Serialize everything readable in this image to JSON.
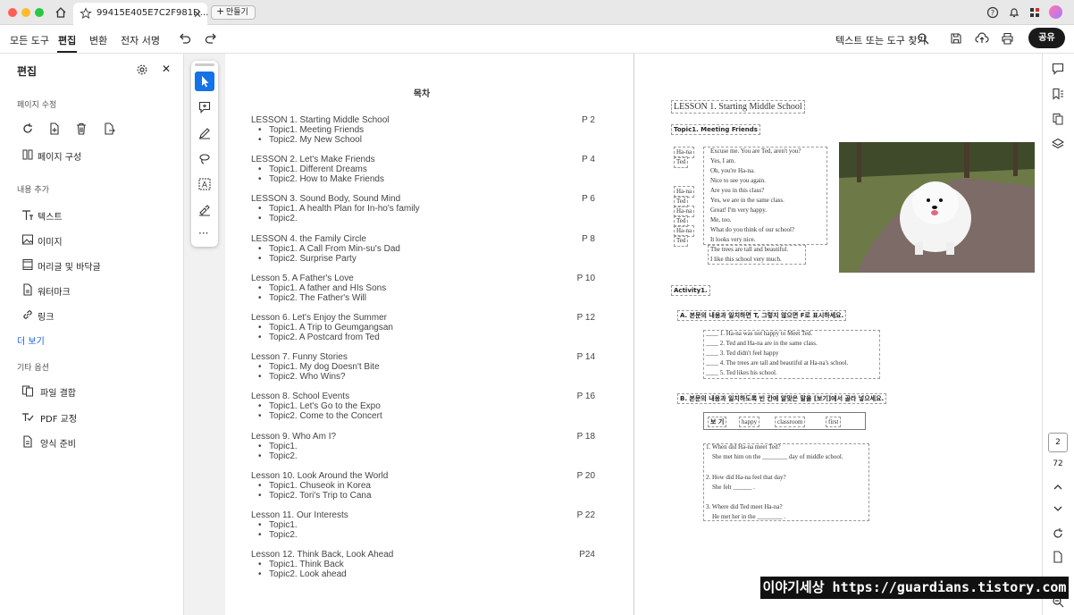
{
  "window": {
    "tab_title": "99415E405E7C2F981D...",
    "new_tab_label": "만들기"
  },
  "menu": {
    "all_tools": "모든 도구",
    "edit": "편집",
    "convert": "변환",
    "esign": "전자 서명",
    "search_label": "텍스트 또는 도구 찾기",
    "share": "공유"
  },
  "sidebar": {
    "title": "편집",
    "sections": {
      "page_edit": "페이지 수정",
      "add_content": "내용 추가",
      "other": "기타 옵션"
    },
    "page_compose": "페이지 구성",
    "add_items": [
      "텍스트",
      "이미지",
      "머리글 및 바닥글",
      "워터마크",
      "링크"
    ],
    "more": "더 보기",
    "other_items": [
      "파일 결합",
      "PDF 교정",
      "양식 준비"
    ]
  },
  "toc": {
    "title": "목차",
    "lessons": [
      {
        "title": "LESSON 1. Starting Middle School",
        "page": "P 2",
        "topics": [
          "Topic1. Meeting Friends",
          "Topic2. My New School"
        ]
      },
      {
        "title": "LESSON 2. Let's Make Friends",
        "page": "P 4",
        "topics": [
          "Topic1. Different Dreams",
          "Topic2. How to Make Friends"
        ]
      },
      {
        "title": "LESSON 3. Sound Body, Sound Mind",
        "page": "P 6",
        "topics": [
          "Topic1. A health Plan for In-ho's family",
          "Topic2."
        ]
      },
      {
        "title": "LESSON 4. the Family Circle",
        "page": "P 8",
        "topics": [
          "Topic1. A Call From Min-su's Dad",
          "Topic2. Surprise Party"
        ]
      },
      {
        "title": "Lesson 5. A Father's Love",
        "page": "P 10",
        "topics": [
          "Topic1. A father and HIs Sons",
          "Topic2. The Father's Will"
        ]
      },
      {
        "title": "Lesson 6. Let's Enjoy the Summer",
        "page": "P 12",
        "topics": [
          "Topic1. A Trip to Geumgangsan",
          "Topic2. A Postcard from Ted"
        ]
      },
      {
        "title": "Lesson 7. Funny Stories",
        "page": "P 14",
        "topics": [
          "Topic1. My dog Doesn't Bite",
          "Topic2. Who Wins?"
        ]
      },
      {
        "title": "Lesson 8. School Events",
        "page": "P 16",
        "topics": [
          "Topic1. Let's Go to the Expo",
          "Topic2. Come to the Concert"
        ]
      },
      {
        "title": "Lesson 9. Who Am I?",
        "page": "P 18",
        "topics": [
          "Topic1.",
          "Topic2."
        ]
      },
      {
        "title": "Lesson 10. Look Around the World",
        "page": "P 20",
        "topics": [
          "Topic1. Chuseok in Korea",
          "Topic2. Tori's Trip to Cana"
        ]
      },
      {
        "title": "Lesson 11. Our Interests",
        "page": "P 22",
        "topics": [
          "Topic1.",
          "Topic2."
        ]
      },
      {
        "title": "Lesson 12. Think Back, Look Ahead",
        "page": "P24",
        "topics": [
          "Topic1. Think Back",
          "Topic2. Look ahead"
        ]
      }
    ]
  },
  "lesson_page": {
    "title": "LESSON 1. Starting Middle School",
    "topic": "Topic1. Meeting Friends",
    "speakers": [
      "Ha-na",
      "Ted",
      "",
      "",
      "Ha-na",
      "Ted",
      "Ha-na",
      "Ted",
      "Ha-na",
      "Ted"
    ],
    "lines": [
      "Excuse me.  You are Ted, aren't you?",
      "Yes, I am.",
      "Oh, you're Ha-na.",
      "Nice to see you again.",
      "Are you in this class?",
      "Yes, we are in the same class.",
      "Great!  I'm very happy.",
      "Me, too.",
      "What do you think of our school?",
      "It looks very nice."
    ],
    "extra_lines": [
      "The trees are tall and beautiful.",
      "I like this school very much."
    ],
    "activity": "Activity1.",
    "partA": "A. 본문의 내용과 일치하면 T, 그렇지 않으면 F로 표시하세요.",
    "tf": [
      "____ 1. Ha-na was not happy to Meet Ted.",
      "____ 2. Ted and Ha-na are in the same class.",
      "____ 3. Ted didn't feel happy",
      "____ 4. The trees are tall and beautiful at Ha-na's school.",
      "____ 5. Ted likes his school."
    ],
    "partB": "B. 본문의 내용과 일치하도록 빈 칸에 알맞은 말을 [보기]에서 골라 넣으세요.",
    "bogi_label": "보 기",
    "bogi": [
      "happy",
      "classroom",
      "first"
    ],
    "q": [
      "1. When did Ha-na meet Ted?",
      "She met him on the ________ day of middle school.",
      "2. How did Ha-na feel that day?",
      "She felt ______ .",
      "3. Where did Ted meet Ha-na?",
      "He met her in the ________ ."
    ]
  },
  "right_rail": {
    "page_current": "2",
    "page_total": "72"
  },
  "watermark": "이야기세상 https://guardians.tistory.com"
}
